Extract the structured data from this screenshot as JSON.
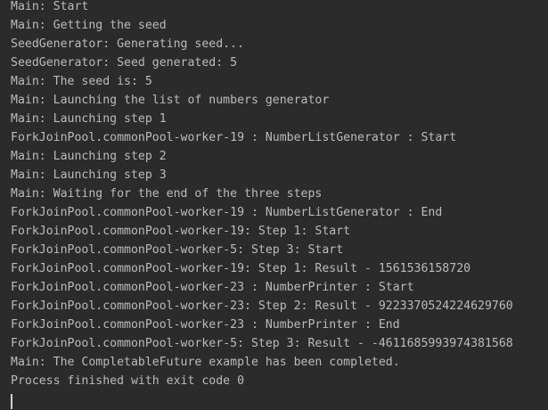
{
  "console": {
    "lines": [
      "Main: Start",
      "Main: Getting the seed",
      "SeedGenerator: Generating seed...",
      "SeedGenerator: Seed generated: 5",
      "Main: The seed is: 5",
      "Main: Launching the list of numbers generator",
      "Main: Launching step 1",
      "ForkJoinPool.commonPool-worker-19 : NumberListGenerator : Start",
      "Main: Launching step 2",
      "Main: Launching step 3",
      "Main: Waiting for the end of the three steps",
      "ForkJoinPool.commonPool-worker-19 : NumberListGenerator : End",
      "ForkJoinPool.commonPool-worker-19: Step 1: Start",
      "ForkJoinPool.commonPool-worker-5: Step 3: Start",
      "ForkJoinPool.commonPool-worker-19: Step 1: Result - 1561536158720",
      "ForkJoinPool.commonPool-worker-23 : NumberPrinter : Start",
      "ForkJoinPool.commonPool-worker-23: Step 2: Result - 9223370524224629760",
      "ForkJoinPool.commonPool-worker-23 : NumberPrinter : End",
      "ForkJoinPool.commonPool-worker-5: Step 3: Result - -4611685993974381568",
      "Main: The CompletableFuture example has been completed.",
      "Process finished with exit code 0"
    ]
  }
}
